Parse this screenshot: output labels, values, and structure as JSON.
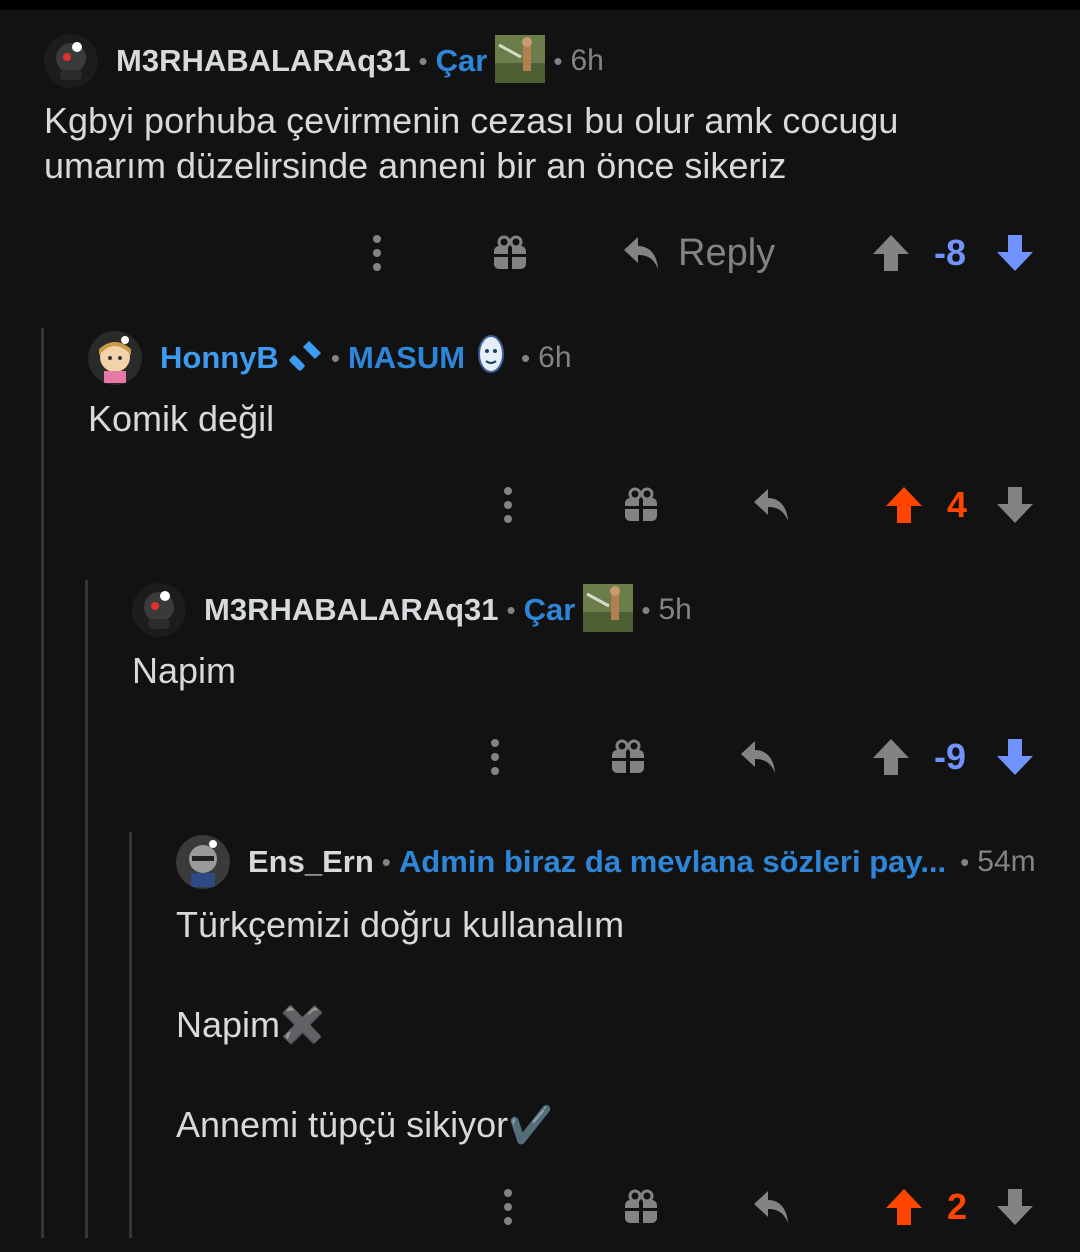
{
  "comments": [
    {
      "username": "M3RHABALARAq31",
      "flair": "Çar",
      "time": "6h",
      "body": "Kgbyi porhuba çevirmenin cezası bu olur amk cocugu\numarım düzelirsinde anneni bir an önce sikeriz",
      "reply_label": "Reply",
      "score": "-8",
      "vote": "down"
    },
    {
      "username": "HonnyB",
      "flair": "MASUM",
      "time": "6h",
      "body": "Komik değil",
      "score": "4",
      "vote": "up"
    },
    {
      "username": "M3RHABALARAq31",
      "flair": "Çar",
      "time": "5h",
      "body": "Napim",
      "score": "-9",
      "vote": "down"
    },
    {
      "username": "Ens_Ern",
      "flair": "Admin biraz da mevlana sözleri pay...",
      "time": "54m",
      "body": "Türkçemizi doğru kullanalım\n\nNapim✖️\n\nAnnemi tüpçü sikiyor✔️",
      "score": "2",
      "vote": "up"
    }
  ],
  "colors": {
    "background": "#121212",
    "text": "#d7dadc",
    "meta": "#818384",
    "flair": "#2e86d8",
    "upvote": "#ff4500",
    "downvote": "#7193ff",
    "thread_line": "#343536"
  },
  "icons": [
    "more-icon",
    "gift-icon",
    "reply-icon",
    "upvote-icon",
    "downvote-icon"
  ]
}
